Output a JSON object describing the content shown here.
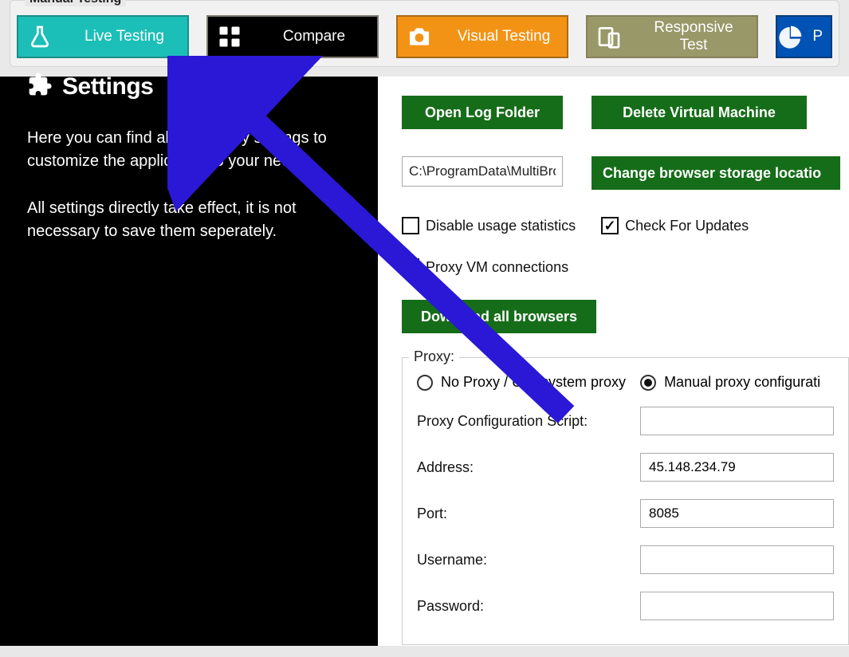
{
  "toolbar": {
    "group_label": "Manual Testing",
    "live": "Live Testing",
    "compare": "Compare",
    "visual": "Visual Testing",
    "responsive": "Responsive Test",
    "truncated": "P"
  },
  "sidebar": {
    "title": "Settings",
    "para1": "Here you can find all necessary settings to customize the application to your needs.",
    "para2": "All settings directly take effect, it is not necessary to save them seperately."
  },
  "buttons": {
    "open_log": "Open Log Folder",
    "delete_vm": "Delete Virtual Machine",
    "change_storage": "Change browser storage locatio",
    "download_all": "Download all browsers"
  },
  "fields": {
    "storage_path": "C:\\ProgramData\\MultiBro"
  },
  "checkboxes": {
    "disable_stats": "Disable usage statistics",
    "check_updates": "Check For Updates",
    "proxy_vm": "Proxy VM connections"
  },
  "proxy": {
    "legend": "Proxy:",
    "no_proxy": "No Proxy / Use system proxy",
    "manual": "Manual proxy configurati",
    "script_label": "Proxy Configuration Script:",
    "script_value": "",
    "address_label": "Address:",
    "address_value": "45.148.234.79",
    "port_label": "Port:",
    "port_value": "8085",
    "username_label": "Username:",
    "username_value": "",
    "password_label": "Password:",
    "password_value": ""
  }
}
